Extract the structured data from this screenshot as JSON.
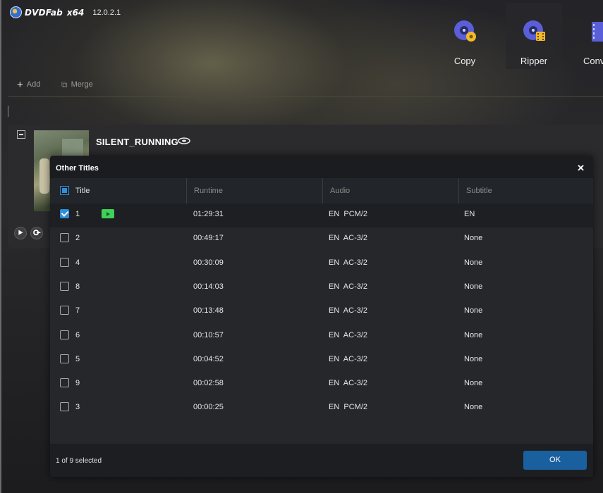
{
  "app": {
    "logo_text": "DVDFab",
    "arch": "x64",
    "version": "12.0.2.1"
  },
  "modes": [
    {
      "label": "Copy",
      "icon": "copy-disc-icon"
    },
    {
      "label": "Ripper",
      "icon": "ripper-disc-icon"
    },
    {
      "label": "Conv",
      "icon": "converter-icon"
    }
  ],
  "active_mode": "Ripper",
  "toolbar": {
    "add_label": "Add",
    "merge_label": "Merge"
  },
  "source": {
    "title": "SILENT_RUNNING",
    "disc_type_icon": "bluray-icon"
  },
  "dialog": {
    "title": "Other Titles",
    "columns": [
      "Title",
      "Runtime",
      "Audio",
      "Subtitle"
    ],
    "rows": [
      {
        "title": "1",
        "runtime": "01:29:31",
        "audio": "EN  PCM/2",
        "subtitle": "EN",
        "checked": true,
        "playable": true
      },
      {
        "title": "2",
        "runtime": "00:49:17",
        "audio": "EN  AC-3/2",
        "subtitle": "None",
        "checked": false
      },
      {
        "title": "4",
        "runtime": "00:30:09",
        "audio": "EN  AC-3/2",
        "subtitle": "None",
        "checked": false
      },
      {
        "title": "8",
        "runtime": "00:14:03",
        "audio": "EN  AC-3/2",
        "subtitle": "None",
        "checked": false
      },
      {
        "title": "7",
        "runtime": "00:13:48",
        "audio": "EN  AC-3/2",
        "subtitle": "None",
        "checked": false
      },
      {
        "title": "6",
        "runtime": "00:10:57",
        "audio": "EN  AC-3/2",
        "subtitle": "None",
        "checked": false
      },
      {
        "title": "5",
        "runtime": "00:04:52",
        "audio": "EN  AC-3/2",
        "subtitle": "None",
        "checked": false
      },
      {
        "title": "9",
        "runtime": "00:02:58",
        "audio": "EN  AC-3/2",
        "subtitle": "None",
        "checked": false
      },
      {
        "title": "3",
        "runtime": "00:00:25",
        "audio": "EN  PCM/2",
        "subtitle": "None",
        "checked": false
      }
    ],
    "selected_text": "1 of 9 selected",
    "ok_label": "OK"
  },
  "colors": {
    "accent": "#1a5f9e",
    "checkbox": "#2d8fd8",
    "play_badge": "#3fd25a"
  }
}
